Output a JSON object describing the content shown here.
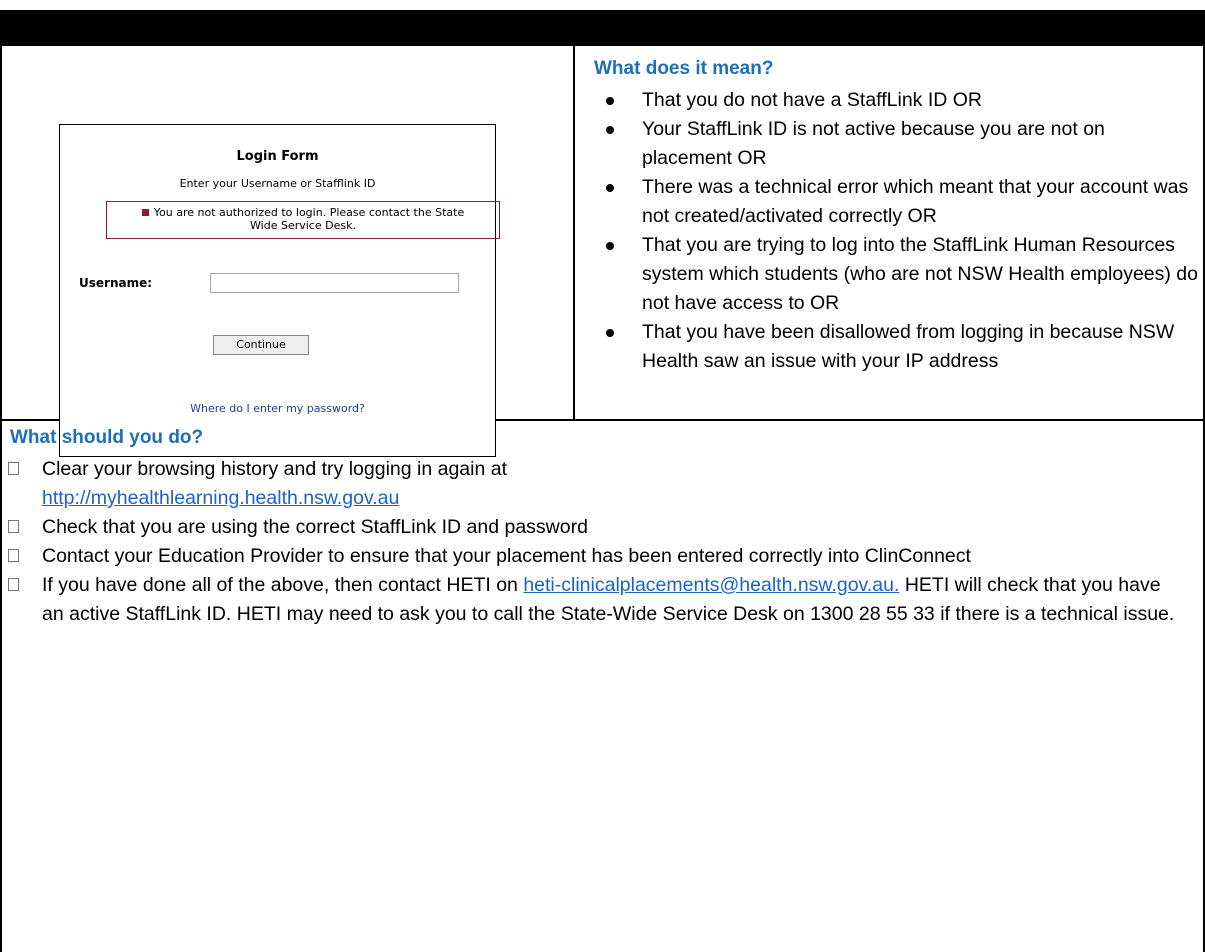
{
  "login_form": {
    "title": "Login Form",
    "subtitle": "Enter your Username or Stafflink ID",
    "error_line1": "You are not authorized to login.   Please contact the State",
    "error_line2": "Wide Service Desk.",
    "username_label": "Username:",
    "username_value": "",
    "continue_label": "Continue",
    "password_link": "Where do I enter my password?"
  },
  "meaning": {
    "heading": "What does it mean?",
    "items": [
      "That you do not have a StaffLink ID OR",
      "Your StaffLink ID is not active because you are not on placement OR",
      "There was a technical error which meant that your account was not created/activated correctly OR",
      "That you are trying to log into the StaffLink Human Resources system which students (who are not NSW Health employees) do not have access to OR",
      "That you have been disallowed from logging in because NSW Health saw an issue with your IP address"
    ]
  },
  "actions": {
    "heading": "What should you do?",
    "item1_text": "Clear your browsing history and try logging in again at",
    "item1_link": "http://myhealthlearning.health.nsw.gov.au",
    "item2_text": "Check that you are using the correct StaffLink ID and password",
    "item3_text": "Contact your Education Provider to ensure that your placement has been entered correctly into ClinConnect",
    "item4_text_before": "If you have done all of the above, then contact HETI on",
    "item4_link": "heti-clinicalplacements@health.nsw.gov.au.",
    "item4_text_after": "HETI will check that you have an active StaffLink ID. HETI may need to ask you to call the State-Wide Service Desk on 1300 28 55 33 if there is a technical issue."
  },
  "colors": {
    "heading_blue": "#1e6fb8",
    "link_blue": "#1a63c8",
    "error_red": "#8b1d2a"
  }
}
